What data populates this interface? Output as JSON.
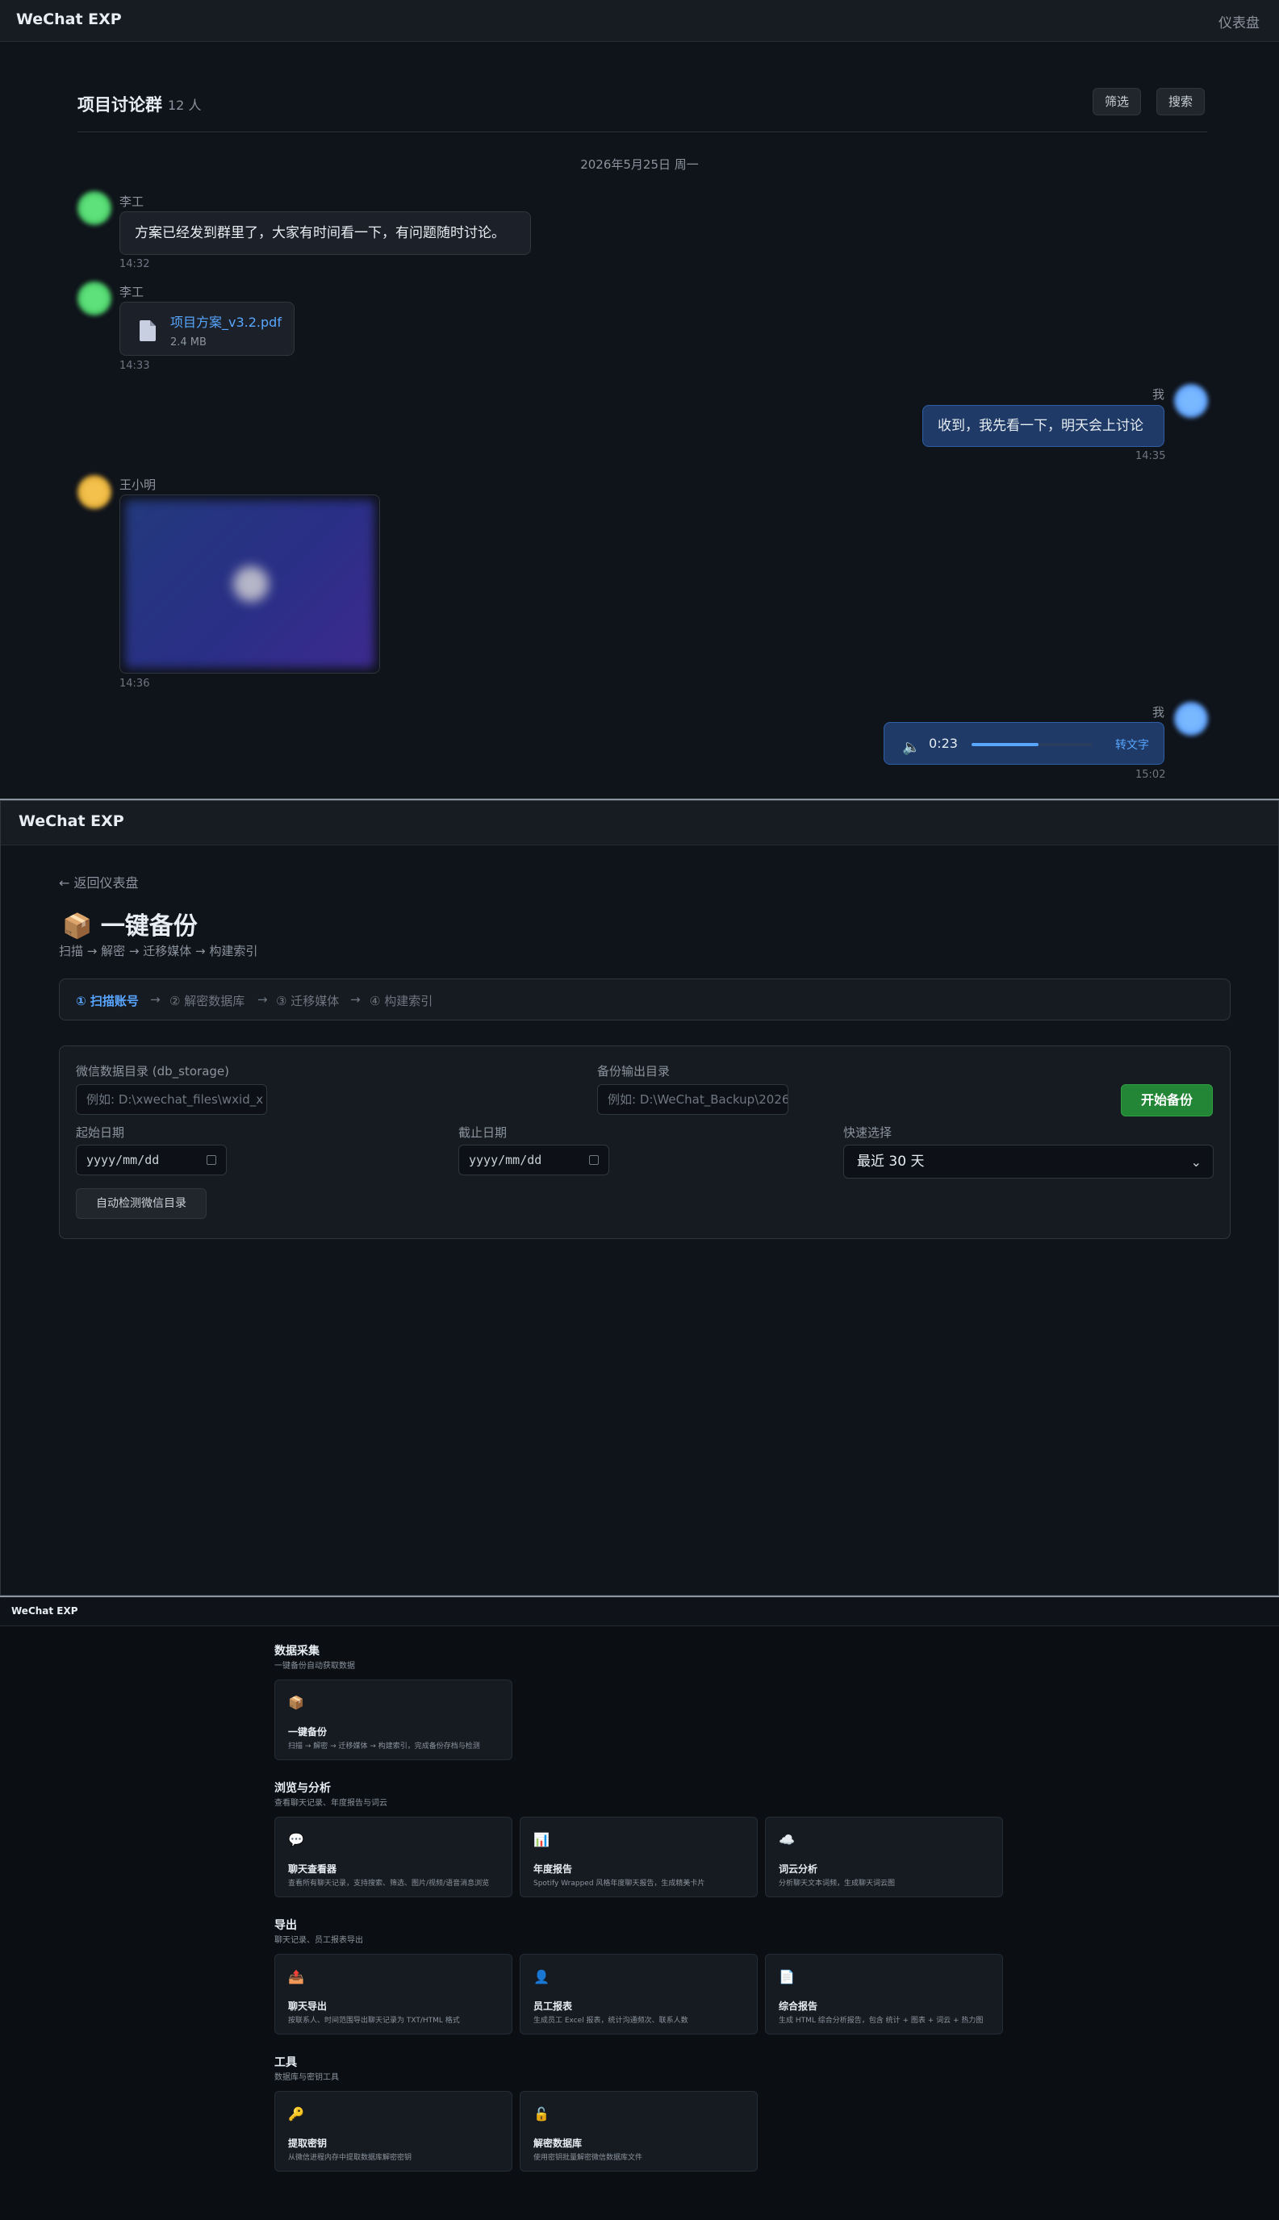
{
  "app_name": "WeChat EXP",
  "chat": {
    "dashboard_link": "仪表盘",
    "group_title": "项目讨论群",
    "member_count": "12 人",
    "filter_button": "筛选",
    "search_button": "搜索",
    "date_separator": "2026年5月25日 周一",
    "messages": [
      {
        "sender": "李工",
        "text": "方案已经发到群里了，大家有时间看一下，有问题随时讨论。",
        "time": "14:32"
      },
      {
        "sender": "李工",
        "file_name": "项目方案_v3.2.pdf",
        "file_size": "2.4 MB",
        "time": "14:33"
      },
      {
        "sender": "我",
        "text": "收到，我先看一下，明天会上讨论",
        "time": "14:35"
      },
      {
        "sender": "王小明",
        "time": "14:36"
      },
      {
        "sender": "我",
        "voice_duration": "0:23",
        "transcribe_label": "转文字",
        "time": "15:02",
        "voice_progress": 0.55
      }
    ]
  },
  "backup": {
    "back_link": "← 返回仪表盘",
    "title_icon": "📦",
    "title": "一键备份",
    "subtitle": "扫描 → 解密 → 迁移媒体 → 构建索引",
    "steps": [
      "① 扫描账号",
      "→",
      "② 解密数据库",
      "→",
      "③ 迁移媒体",
      "→",
      "④ 构建索引"
    ],
    "db_label": "微信数据目录 (db_storage)",
    "db_placeholder": "例如: D:\\xwechat_files\\wxid_x",
    "output_label": "备份输出目录",
    "output_placeholder": "例如: D:\\WeChat_Backup\\2026",
    "start_button": "开始备份",
    "start_date_label": "起始日期",
    "start_date_value": "yyyy/mm/dd",
    "end_date_label": "截止日期",
    "end_date_value": "yyyy/mm/dd",
    "quick_label": "快速选择",
    "quick_value": "最近 30 天",
    "detect_button": "自动检测微信目录"
  },
  "dashboard": {
    "sections": [
      {
        "title": "数据采集",
        "subtitle": "一键备份自动获取数据",
        "tools": [
          {
            "icon": "📦",
            "name": "一键备份",
            "desc": "扫描 → 解密 → 迁移媒体 → 构建索引，完成备份存档与检测"
          }
        ]
      },
      {
        "title": "浏览与分析",
        "subtitle": "查看聊天记录、年度报告与词云",
        "tools": [
          {
            "icon": "💬",
            "name": "聊天查看器",
            "desc": "查看所有聊天记录，支持搜索、筛选、图片/视频/语音消息浏览"
          },
          {
            "icon": "📊",
            "name": "年度报告",
            "desc": "Spotify Wrapped 风格年度聊天报告，生成精美卡片"
          },
          {
            "icon": "☁️",
            "name": "词云分析",
            "desc": "分析聊天文本词频，生成聊天词云图"
          }
        ]
      },
      {
        "title": "导出",
        "subtitle": "聊天记录、员工报表导出",
        "tools": [
          {
            "icon": "📤",
            "name": "聊天导出",
            "desc": "按联系人、时间范围导出聊天记录为 TXT/HTML 格式"
          },
          {
            "icon": "👤",
            "name": "员工报表",
            "desc": "生成员工 Excel 报表，统计沟通频次、联系人数"
          },
          {
            "icon": "📄",
            "name": "综合报告",
            "desc": "生成 HTML 综合分析报告，包含 统计 + 图表 + 词云 + 热力图"
          }
        ]
      },
      {
        "title": "工具",
        "subtitle": "数据库与密钥工具",
        "tools": [
          {
            "icon": "🔑",
            "name": "提取密钥",
            "desc": "从微信进程内存中提取数据库解密密钥"
          },
          {
            "icon": "🔓",
            "name": "解密数据库",
            "desc": "使用密钥批量解密微信数据库文件"
          }
        ]
      }
    ]
  },
  "colors": {
    "accent": "#58a6ff",
    "success": "#238636",
    "bg": "#0f131a"
  }
}
